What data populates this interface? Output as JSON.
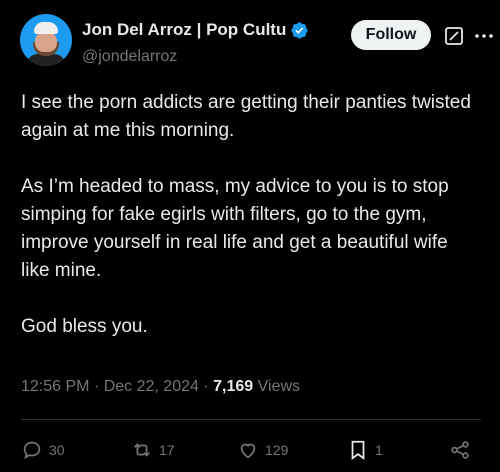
{
  "author": {
    "display_name": "Jon Del Arroz | Pop Cultu",
    "handle": "@jondelarroz",
    "verified": true
  },
  "follow_label": "Follow",
  "tweet": {
    "text": "I see the porn addicts are getting their panties twisted again at me this morning.\n\nAs I’m headed to mass, my advice to you is to stop simping for fake egirls with filters, go to the gym, improve yourself in real life and get a beautiful wife like mine.\n\nGod bless you."
  },
  "meta": {
    "time": "12:56 PM",
    "separator": "·",
    "date": "Dec 22, 2024",
    "views_count": "7,169",
    "views_label": "Views"
  },
  "actions": {
    "replies": "30",
    "reposts": "17",
    "likes": "129",
    "bookmarks": "1"
  },
  "colors": {
    "background": "#000000",
    "text": "#e7e9ea",
    "muted": "#71767b",
    "verified": "#1d9bf0",
    "follow_bg": "#eff3f4"
  }
}
